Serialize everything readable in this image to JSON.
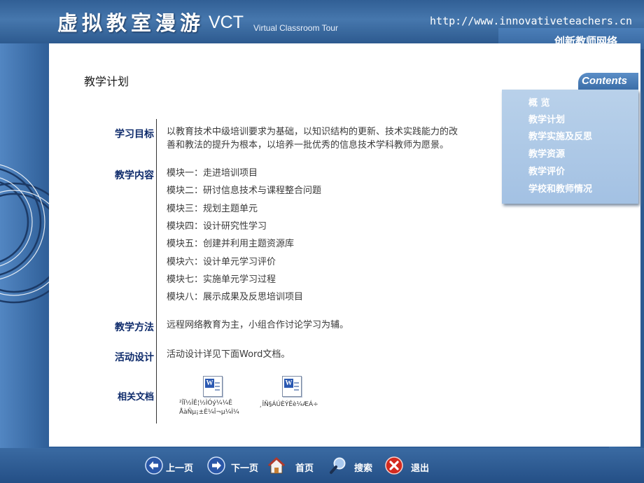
{
  "header": {
    "logo_cn": "虚拟教室漫游",
    "logo_en": "VCT",
    "logo_sub": "Virtual Classroom Tour",
    "url": "http://www.innovativeteachers.cn",
    "site_name": "创新教师网络"
  },
  "sidebar": {
    "tab_label": "Contents",
    "items": [
      {
        "label": "概  览"
      },
      {
        "label": "教学计划"
      },
      {
        "label": "教学实施及反思"
      },
      {
        "label": "教学资源"
      },
      {
        "label": "教学评价"
      },
      {
        "label": "学校和教师情况"
      }
    ]
  },
  "page": {
    "title": "教学计划",
    "goal_label": "学习目标",
    "goal_text_line1": "以教育技术中级培训要求为基础，以知识结构的更新、技术实践能力的改",
    "goal_text_line2": "善和教法的提升为根本，以培养一批优秀的信息技术学科教师为愿景。",
    "content_label": "教学内容",
    "modules": [
      "模块一：走进培训项目",
      "模块二：研讨信息技术与课程整合问题",
      "模块三：规划主题单元",
      "模块四：设计研究性学习",
      "模块五：创建并利用主题资源库",
      "模块六：设计单元学习评价",
      "模块七：实施单元学习过程",
      "模块八：展示成果及反思培训项目"
    ],
    "method_label": "教学方法",
    "method_text": "远程网络教育为主，小组合作讨论学习为辅。",
    "activity_label": "活动设计",
    "activity_text": "活动设计详见下面Word文档。",
    "docs_label": "相关文档",
    "docs": [
      {
        "name_line1": "²ÎÏ½ÎÊ¦½ÌÓý¼¼Ê",
        "name_line2": "ÅàÑµ¡±È¼Î¬µ¼Ì¼"
      },
      {
        "name_line1": "¸ÎÑ§ÁÚÈÝÊè¼ÆÁ÷",
        "name_line2": ""
      }
    ]
  },
  "nav": {
    "prev": "上一页",
    "next": "下一页",
    "home": "首页",
    "search": "搜索",
    "exit": "退出"
  }
}
